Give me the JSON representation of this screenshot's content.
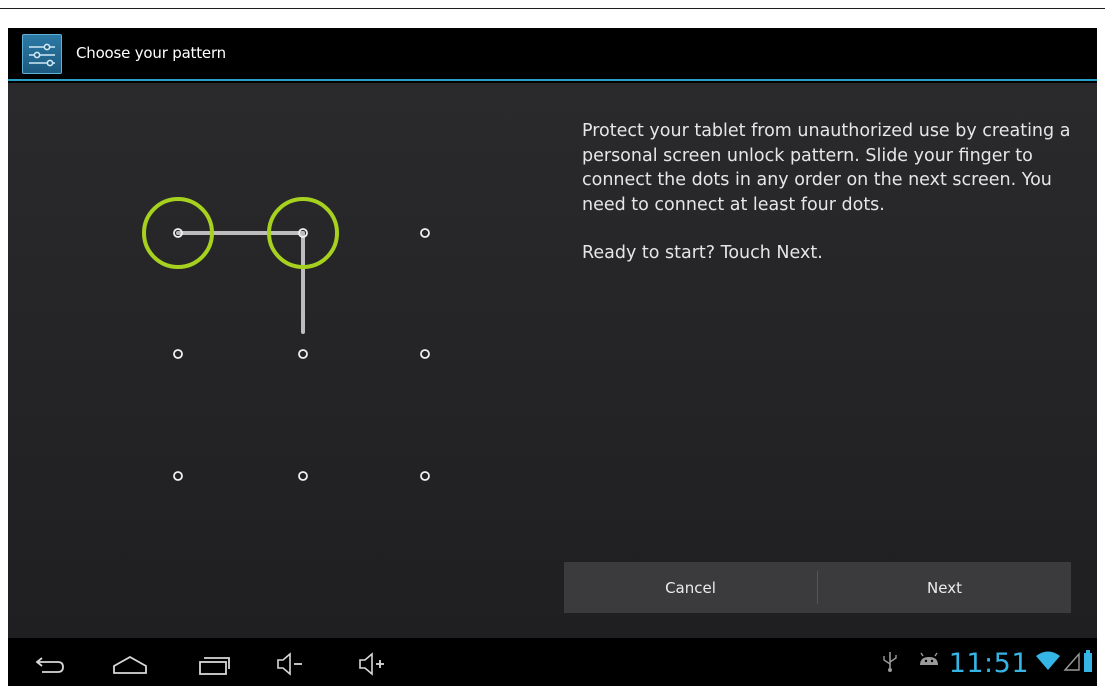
{
  "action_bar": {
    "title": "Choose your pattern",
    "icon": "settings-sliders-icon",
    "divider_color": "#2ba0c7"
  },
  "pattern": {
    "dots": 9,
    "connected_sequence": [
      1,
      2,
      5
    ],
    "highlight_color": "#a6d11f"
  },
  "instructions": {
    "paragraph1": "Protect your tablet from unauthorized use by creating a personal screen unlock pattern. Slide your finger to connect the dots in any order on the next screen. You need to connect at least four dots.",
    "paragraph2": "Ready to start? Touch Next."
  },
  "buttons": {
    "cancel": "Cancel",
    "next": "Next"
  },
  "nav_bar": {
    "buttons": [
      "back-icon",
      "home-icon",
      "recent-apps-icon",
      "volume-down-icon",
      "volume-up-icon"
    ],
    "status_icons": [
      "usb-icon",
      "android-debug-icon",
      "wifi-icon",
      "signal-icon",
      "battery-icon"
    ],
    "time": "11:51",
    "accent_color": "#35b5e5"
  }
}
